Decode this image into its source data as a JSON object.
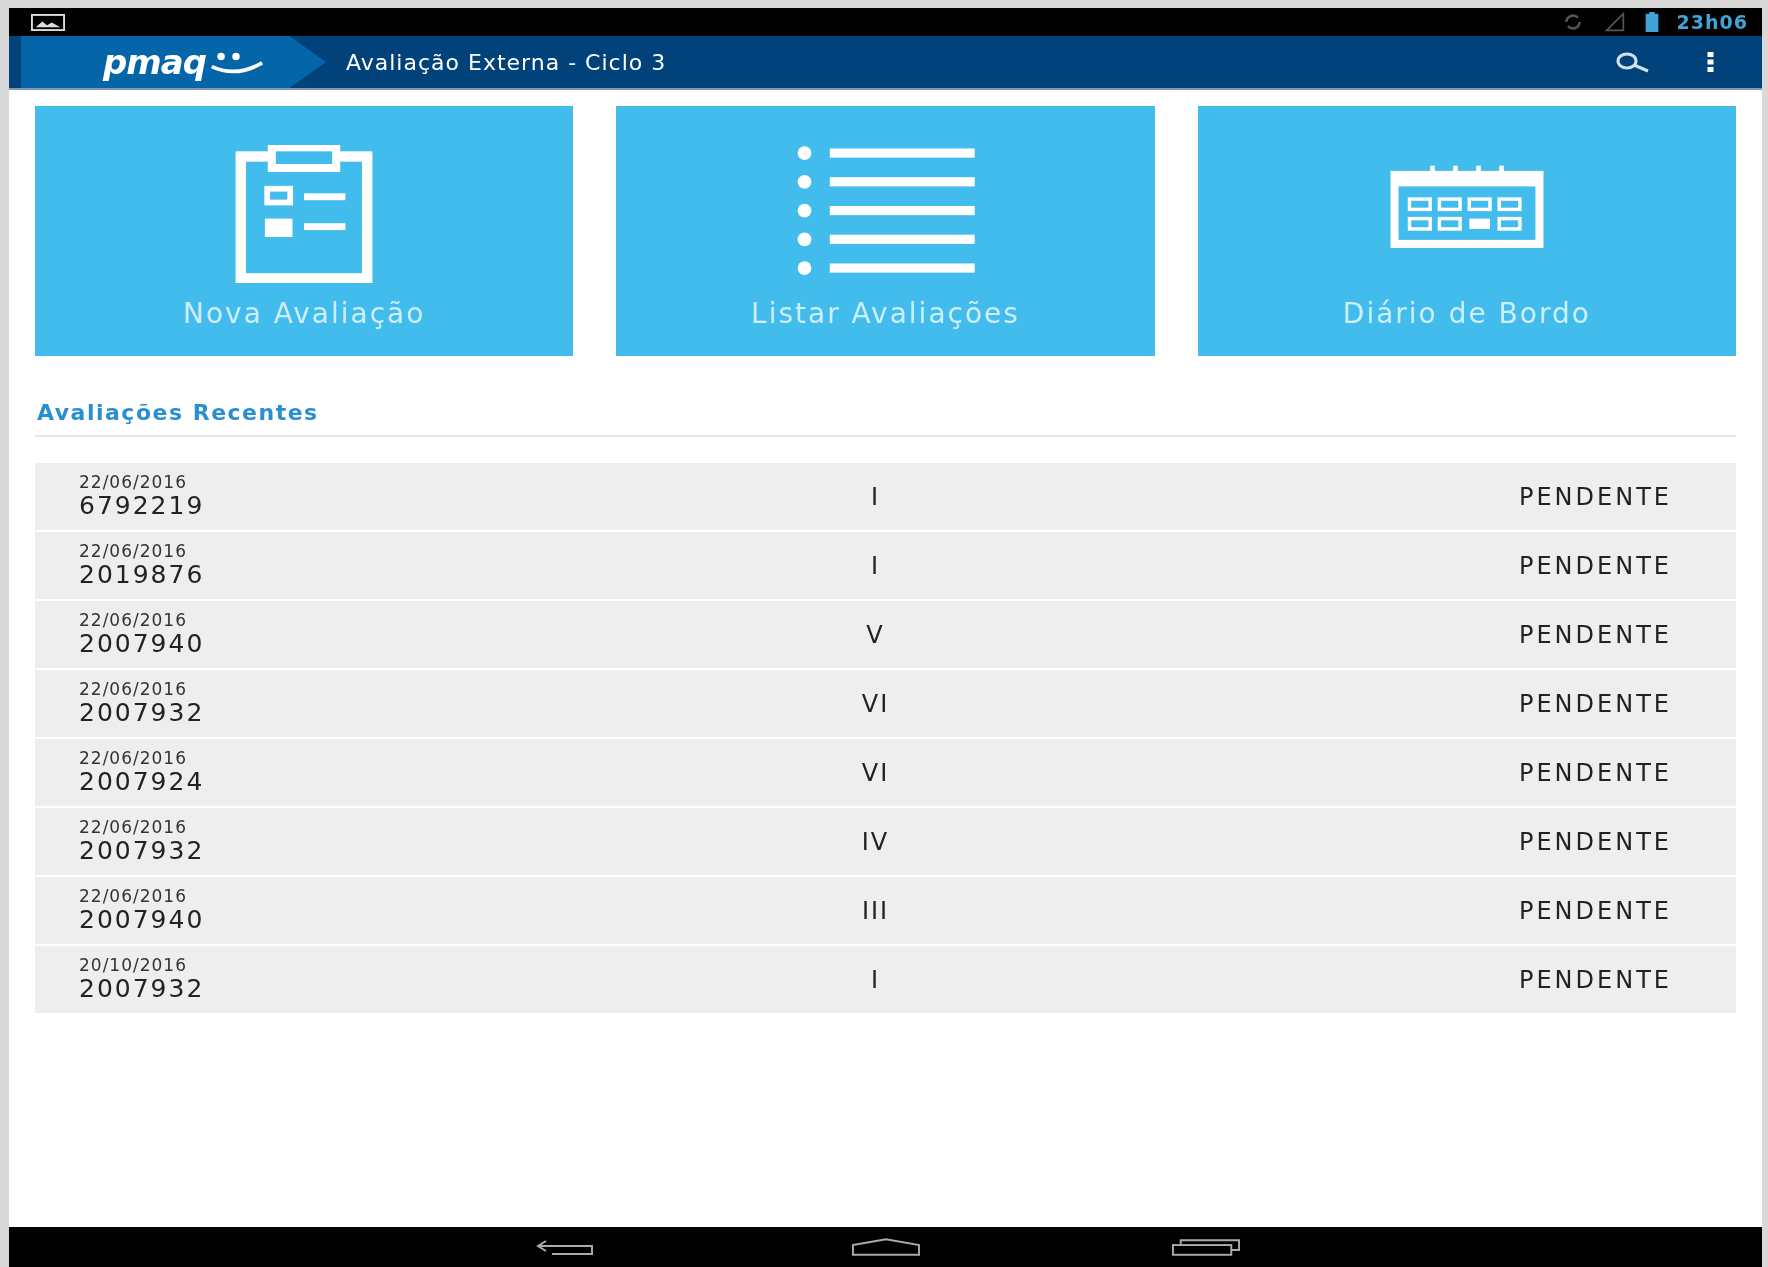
{
  "status_bar": {
    "time": "23h06"
  },
  "app_bar": {
    "logo": "pmaq",
    "title": "Avaliação Externa - Ciclo 3"
  },
  "tiles": [
    {
      "kind": "clipboard",
      "label": "Nova Avaliação"
    },
    {
      "kind": "list",
      "label": "Listar Avaliações"
    },
    {
      "kind": "calendar",
      "label": "Diário de Bordo"
    }
  ],
  "recent": {
    "title": "Avaliações Recentes",
    "rows": [
      {
        "date": "22/06/2016",
        "code": "6792219",
        "cycle": "I",
        "status": "PENDENTE"
      },
      {
        "date": "22/06/2016",
        "code": "2019876",
        "cycle": "I",
        "status": "PENDENTE"
      },
      {
        "date": "22/06/2016",
        "code": "2007940",
        "cycle": "V",
        "status": "PENDENTE"
      },
      {
        "date": "22/06/2016",
        "code": "2007932",
        "cycle": "VI",
        "status": "PENDENTE"
      },
      {
        "date": "22/06/2016",
        "code": "2007924",
        "cycle": "VI",
        "status": "PENDENTE"
      },
      {
        "date": "22/06/2016",
        "code": "2007932",
        "cycle": "IV",
        "status": "PENDENTE"
      },
      {
        "date": "22/06/2016",
        "code": "2007940",
        "cycle": "III",
        "status": "PENDENTE"
      },
      {
        "date": "20/10/2016",
        "code": "2007932",
        "cycle": "I",
        "status": "PENDENTE"
      }
    ]
  }
}
